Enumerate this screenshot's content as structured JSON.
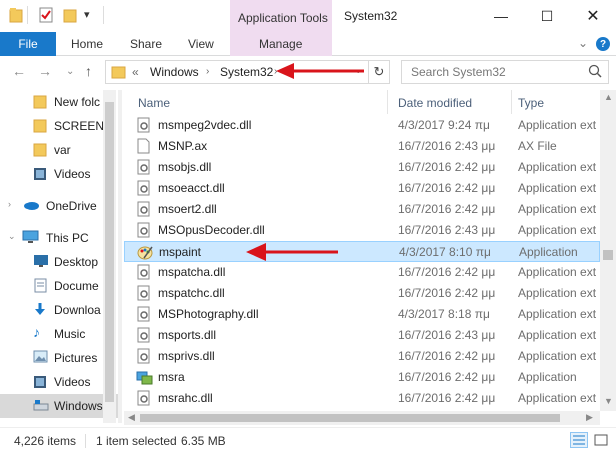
{
  "titlebar": {
    "title": "System32",
    "context_group": "Application Tools",
    "controls": [
      "minimize",
      "maximize",
      "close"
    ]
  },
  "ribbon": {
    "file_label": "File",
    "tabs": [
      "Home",
      "Share",
      "View"
    ],
    "context_tab": "Manage"
  },
  "address": {
    "overflow": "«",
    "crumbs": [
      "Windows",
      "System32"
    ],
    "search_placeholder": "Search System32"
  },
  "nav": {
    "items": [
      {
        "label": "New folc",
        "icon": "folder-icon"
      },
      {
        "label": "SCREENS",
        "icon": "folder-icon"
      },
      {
        "label": "var",
        "icon": "folder-icon"
      },
      {
        "label": "Videos",
        "icon": "videos-icon"
      },
      {
        "label": "OneDrive",
        "icon": "onedrive-icon"
      },
      {
        "label": "This PC",
        "icon": "this-pc-icon"
      },
      {
        "label": "Desktop",
        "icon": "desktop-icon"
      },
      {
        "label": "Docume",
        "icon": "documents-icon"
      },
      {
        "label": "Downloa",
        "icon": "downloads-icon"
      },
      {
        "label": "Music",
        "icon": "music-icon"
      },
      {
        "label": "Pictures",
        "icon": "pictures-icon"
      },
      {
        "label": "Videos",
        "icon": "videos-icon"
      },
      {
        "label": "Windows",
        "icon": "drive-icon"
      }
    ]
  },
  "columns": {
    "name": "Name",
    "date": "Date modified",
    "type": "Type"
  },
  "files": [
    {
      "name": "msmpeg2vdec.dll",
      "date": "4/3/2017 9:24 πμ",
      "type": "Application ext",
      "icon": "dll-icon"
    },
    {
      "name": "MSNP.ax",
      "date": "16/7/2016 2:43 μμ",
      "type": "AX File",
      "icon": "file-icon"
    },
    {
      "name": "msobjs.dll",
      "date": "16/7/2016 2:42 μμ",
      "type": "Application ext",
      "icon": "dll-icon"
    },
    {
      "name": "msoeacct.dll",
      "date": "16/7/2016 2:42 μμ",
      "type": "Application ext",
      "icon": "dll-icon"
    },
    {
      "name": "msoert2.dll",
      "date": "16/7/2016 2:42 μμ",
      "type": "Application ext",
      "icon": "dll-icon"
    },
    {
      "name": "MSOpusDecoder.dll",
      "date": "16/7/2016 2:43 μμ",
      "type": "Application ext",
      "icon": "dll-icon"
    },
    {
      "name": "mspaint",
      "date": "4/3/2017 8:10 πμ",
      "type": "Application",
      "icon": "paint-icon"
    },
    {
      "name": "mspatcha.dll",
      "date": "16/7/2016 2:42 μμ",
      "type": "Application ext",
      "icon": "dll-icon"
    },
    {
      "name": "mspatchc.dll",
      "date": "16/7/2016 2:42 μμ",
      "type": "Application ext",
      "icon": "dll-icon"
    },
    {
      "name": "MSPhotography.dll",
      "date": "4/3/2017 8:18 πμ",
      "type": "Application ext",
      "icon": "dll-icon"
    },
    {
      "name": "msports.dll",
      "date": "16/7/2016 2:43 μμ",
      "type": "Application ext",
      "icon": "dll-icon"
    },
    {
      "name": "msprivs.dll",
      "date": "16/7/2016 2:42 μμ",
      "type": "Application ext",
      "icon": "dll-icon"
    },
    {
      "name": "msra",
      "date": "16/7/2016 2:42 μμ",
      "type": "Application",
      "icon": "msra-icon"
    },
    {
      "name": "msrahc.dll",
      "date": "16/7/2016 2:42 μμ",
      "type": "Application ext",
      "icon": "dll-icon"
    }
  ],
  "selected_file": "mspaint",
  "status": {
    "count": "4,226 items",
    "selection": "1 item selected",
    "size": "6.35 MB"
  },
  "colors": {
    "accent": "#1979ca",
    "context_tab": "#f0dcf0",
    "selection": "#cce8ff",
    "annotation": "#d9141b"
  }
}
